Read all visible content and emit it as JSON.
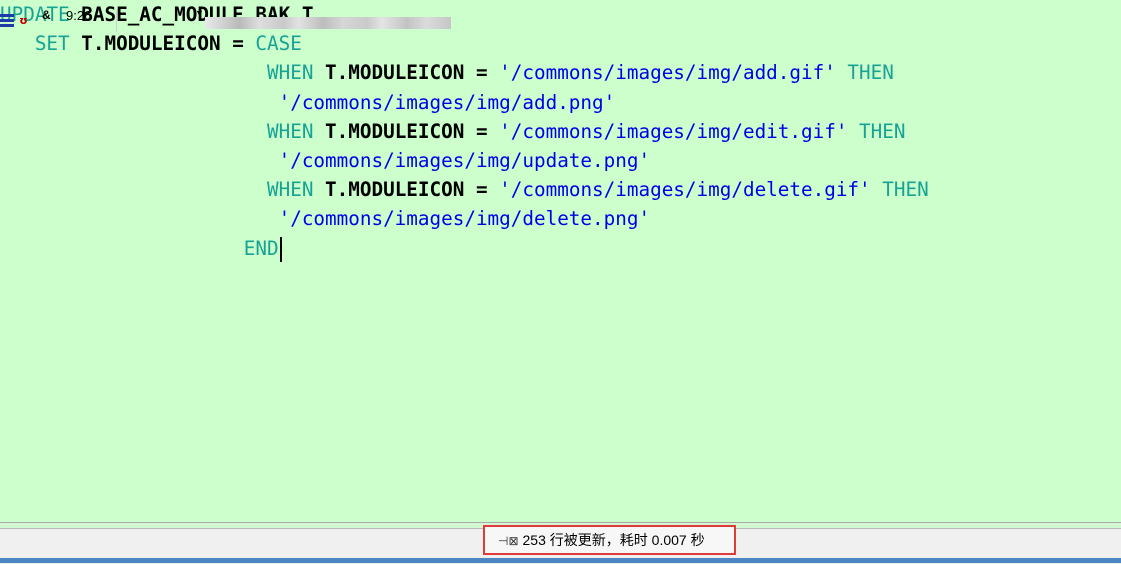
{
  "editor": {
    "lines": [
      [
        {
          "text": "UPDATE",
          "cls": "kw"
        },
        {
          "text": " ",
          "cls": "id"
        },
        {
          "text": "BASE_AC_MODULE_BAK T",
          "cls": "id"
        }
      ],
      [
        {
          "text": "   SET",
          "cls": "kw"
        },
        {
          "text": " T.MODULEICON ",
          "cls": "id"
        },
        {
          "text": "=",
          "cls": "op"
        },
        {
          "text": " CASE",
          "cls": "kw"
        }
      ],
      [
        {
          "text": "                       WHEN",
          "cls": "kw"
        },
        {
          "text": " T.MODULEICON ",
          "cls": "id"
        },
        {
          "text": "=",
          "cls": "op"
        },
        {
          "text": " '/commons/images/img/add.gif'",
          "cls": "str"
        },
        {
          "text": " THEN",
          "cls": "kw"
        }
      ],
      [
        {
          "text": "                        '/commons/images/img/add.png'",
          "cls": "str"
        }
      ],
      [
        {
          "text": "                       WHEN",
          "cls": "kw"
        },
        {
          "text": " T.MODULEICON ",
          "cls": "id"
        },
        {
          "text": "=",
          "cls": "op"
        },
        {
          "text": " '/commons/images/img/edit.gif'",
          "cls": "str"
        },
        {
          "text": " THEN",
          "cls": "kw"
        }
      ],
      [
        {
          "text": "                        '/commons/images/img/update.png'",
          "cls": "str"
        }
      ],
      [
        {
          "text": "                       WHEN",
          "cls": "kw"
        },
        {
          "text": " T.MODULEICON ",
          "cls": "id"
        },
        {
          "text": "=",
          "cls": "op"
        },
        {
          "text": " '/commons/images/img/delete.gif'",
          "cls": "str"
        },
        {
          "text": " THEN",
          "cls": "kw"
        }
      ],
      [
        {
          "text": "                        '/commons/images/img/delete.png'",
          "cls": "str"
        }
      ],
      [
        {
          "text": "                     END",
          "cls": "kw"
        }
      ]
    ]
  },
  "statusbar": {
    "mode_icon": "editor-mode-icon",
    "record_icon": "record-macro-icon",
    "amp_label": "&",
    "cursor_position": "9:26",
    "dropdown_icon": "dropdown-arrow-icon",
    "result_icon": "pin-icon",
    "result_text": "253 行被更新，耗时 0.007 秒"
  },
  "colors": {
    "editor_background": "#ccffcc",
    "keyword": "#16a396",
    "string": "#0000e8",
    "identifier": "#000000",
    "highlight_box": "#e03a3a"
  }
}
